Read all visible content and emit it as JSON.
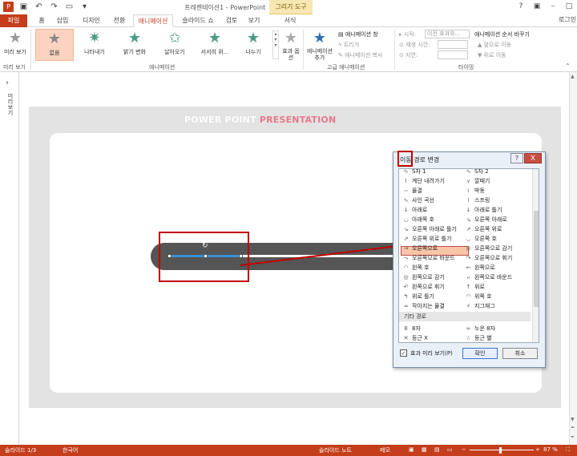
{
  "window": {
    "title": "프레젠테이션1 - PowerPoint",
    "context_tab": "그리기 도구",
    "login": "로그인"
  },
  "tabs": [
    "파일",
    "홈",
    "삽입",
    "디자인",
    "전환",
    "애니메이션",
    "슬라이드 쇼",
    "검토",
    "보기",
    "서식"
  ],
  "ribbon": {
    "preview": {
      "label": "미리 보기",
      "group": "미리 보기"
    },
    "animations": [
      {
        "label": "없음"
      },
      {
        "label": "나타내기"
      },
      {
        "label": "밝기 변화"
      },
      {
        "label": "날아오기"
      },
      {
        "label": "서서히 위..."
      },
      {
        "label": "나누기"
      }
    ],
    "effect_options": "효과 옵션",
    "group_animation": "애니메이션",
    "add_animation": "애니메이션 추가",
    "anim_pane": "애니메이션 창",
    "trigger": "트리거",
    "anim_painter": "애니메이션 복사",
    "group_advanced": "고급 애니메이션",
    "start_label": "시작:",
    "start_value": "이전 효과와...",
    "duration_label": "재생 시간:",
    "delay_label": "지연:",
    "reorder_title": "애니메이션 순서 바꾸기",
    "move_earlier": "앞으로 이동",
    "move_later": "뒤로 이동",
    "group_timing": "타이밍"
  },
  "left_pane": {
    "label": "미리보기"
  },
  "slide": {
    "title_part1": "POWER POINT",
    "title_part2": "PRESENTATION"
  },
  "dialog": {
    "title": "이동 경로 변경",
    "help": "?",
    "close": "X",
    "items_left": [
      "S자 1",
      "계단 내려가기",
      "물결",
      "사인 곡선",
      "아래로",
      "아래쪽 호",
      "오른쪽 아래로 틀기",
      "오른쪽 위로 틀기",
      "오른쪽으로",
      "오른쪽으로 바운드",
      "왼쪽 호",
      "왼쪽으로 감기",
      "왼쪽으로 휘기",
      "위로 틀기",
      "작아지는 물결"
    ],
    "items_right": [
      "S자 2",
      "깔때기",
      "박동",
      "스프링",
      "아래로 틀기",
      "오른쪽 아래로",
      "오른쪽 위로",
      "오른쪽 호",
      "오른쪽으로 감기",
      "오른쪽으로 휘기",
      "왼쪽으로",
      "왼쪽으로 바운드",
      "위로",
      "위쪽 호",
      "지그재그"
    ],
    "section": "기타 경로",
    "other_left": [
      "8자",
      "등근 X"
    ],
    "other_right": [
      "누운 8자",
      "등근 별"
    ],
    "preview_check": "효과 미리 보기(P)",
    "ok": "확인",
    "cancel": "취소"
  },
  "status": {
    "slide": "슬라이드 1/3",
    "lang": "한국어",
    "notes": "슬라이드 노트",
    "comments": "메모",
    "zoom": "87 %"
  }
}
